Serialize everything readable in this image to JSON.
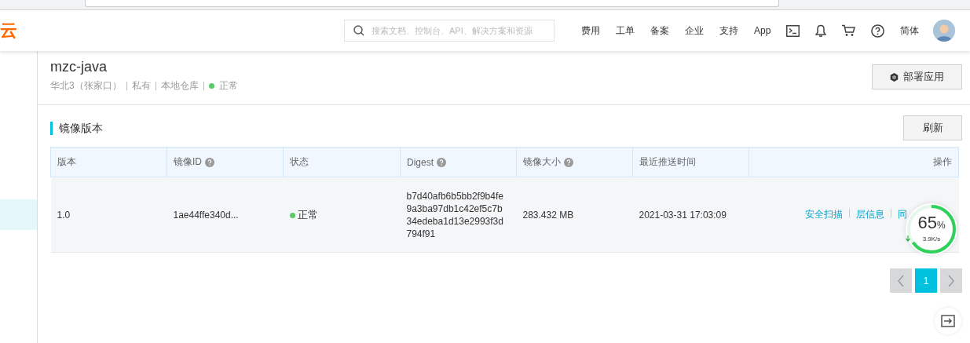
{
  "header": {
    "logo": "云",
    "search": {
      "placeholder": "搜索文档、控制台、API、解决方案和资源"
    },
    "nav": [
      "费用",
      "工单",
      "备案",
      "企业",
      "支持",
      "App"
    ],
    "language": "简体"
  },
  "sidebar": {
    "items": [
      {
        "selected": true
      }
    ]
  },
  "repository": {
    "name": "mzc-java",
    "meta": [
      "华北3（张家口）",
      "私有",
      "本地仓库"
    ],
    "status": "正常",
    "deploy_button": "部署应用"
  },
  "section": {
    "title": "镜像版本",
    "refresh_button": "刷新"
  },
  "table": {
    "columns": [
      {
        "label": "版本",
        "help": false
      },
      {
        "label": "镜像ID",
        "help": true
      },
      {
        "label": "状态",
        "help": false
      },
      {
        "label": "Digest",
        "help": true
      },
      {
        "label": "镜像大小",
        "help": true
      },
      {
        "label": "最近推送时间",
        "help": false
      },
      {
        "label": "操作",
        "help": false
      }
    ],
    "rows": [
      {
        "version": "1.0",
        "image_id": "1ae44ffe340d...",
        "status": "正常",
        "digest": [
          "b7d40afb6b5bb2f9b4fe",
          "9a3ba97db1c42ef5c7b",
          "34edeba1d13e2993f3d",
          "794f91"
        ],
        "size": "283.432 MB",
        "pushed": "2021-03-31 17:03:09",
        "actions": [
          "安全扫描",
          "层信息",
          "同"
        ]
      }
    ]
  },
  "pagination": {
    "pages": [
      {
        "label": "1",
        "selected": true
      }
    ]
  },
  "speed_widget": {
    "percent": "65",
    "unit": "%",
    "speed": "3.9K/s",
    "level": 0.65
  }
}
